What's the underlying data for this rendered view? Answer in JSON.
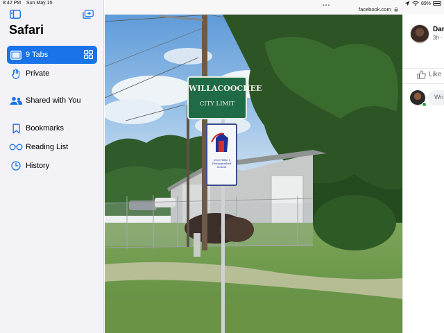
{
  "status_bar": {
    "time": "8:42 PM",
    "date": "Sun May 15",
    "battery": "89%"
  },
  "sidebar": {
    "title": "Safari",
    "items": [
      {
        "label": "9 Tabs",
        "icon": "tabs-icon",
        "selected": true
      },
      {
        "label": "Private",
        "icon": "hand-raised-icon"
      },
      {
        "label": "Shared with You",
        "icon": "people-icon"
      },
      {
        "label": "Bookmarks",
        "icon": "bookmark-icon"
      },
      {
        "label": "Reading List",
        "icon": "glasses-icon"
      },
      {
        "label": "History",
        "icon": "clock-icon"
      }
    ]
  },
  "browser": {
    "dots": "•••",
    "domain": "facebook.com"
  },
  "photo": {
    "sign_title": "WILLACOOCHEE",
    "sign_subtitle": "CITY LIMIT",
    "small_sign_text": "2020 Title I Distinguished School"
  },
  "facebook": {
    "author_name": "Dar",
    "post_time": "3h ·",
    "like_label": "Like",
    "comment_placeholder": "Wri"
  },
  "colors": {
    "accent": "#1a73e8",
    "sidebar_bg": "#f2f2f7",
    "sign_green": "#1f6b45"
  }
}
